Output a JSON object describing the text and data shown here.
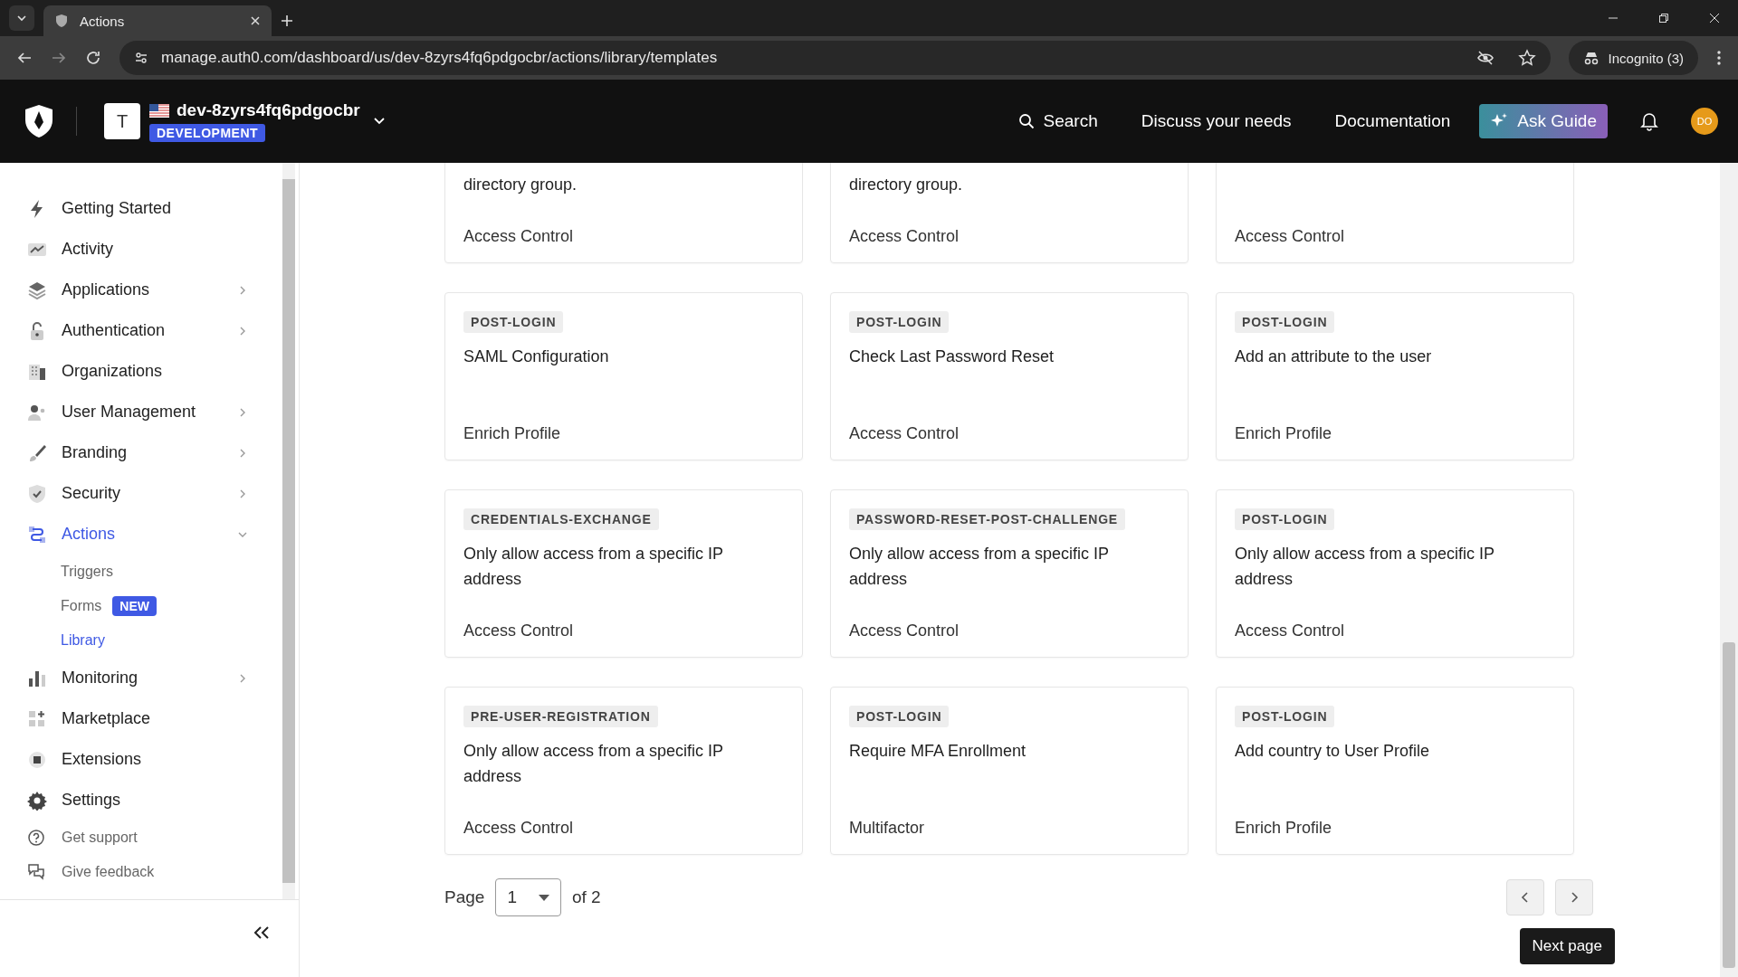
{
  "browser": {
    "tab_title": "Actions",
    "url": "manage.auth0.com/dashboard/us/dev-8zyrs4fq6pdgocbr/actions/library/templates",
    "profile": "Incognito (3)"
  },
  "header": {
    "tenant_initial": "T",
    "tenant_name": "dev-8zyrs4fq6pdgocbr",
    "environment": "DEVELOPMENT",
    "links": [
      "Search",
      "Discuss your needs",
      "Documentation"
    ],
    "ask_button": "Ask Guide",
    "avatar": "DO"
  },
  "sidebar": {
    "items": [
      {
        "label": "Getting Started",
        "selected": false
      },
      {
        "label": "Activity",
        "selected": false
      },
      {
        "label": "Applications",
        "expanded": false,
        "selected": false
      },
      {
        "label": "Authentication",
        "expanded": false,
        "selected": false
      },
      {
        "label": "Organizations",
        "selected": false
      },
      {
        "label": "User Management",
        "expanded": false,
        "selected": false
      },
      {
        "label": "Branding",
        "expanded": false,
        "selected": false
      },
      {
        "label": "Security",
        "expanded": false,
        "selected": false
      },
      {
        "label": "Actions",
        "expanded": true,
        "selected": true,
        "children": [
          {
            "label": "Triggers",
            "selected": false
          },
          {
            "label": "Forms",
            "badge": "NEW",
            "selected": false
          },
          {
            "label": "Library",
            "selected": true
          }
        ]
      },
      {
        "label": "Monitoring",
        "expanded": false,
        "selected": false
      },
      {
        "label": "Marketplace",
        "selected": false
      },
      {
        "label": "Extensions",
        "selected": false
      },
      {
        "label": "Settings",
        "selected": false
      }
    ],
    "footer_links": [
      "Get support",
      "Give feedback"
    ]
  },
  "templates": [
    {
      "title": "directory group.",
      "category": "Access Control"
    },
    {
      "title": "directory group.",
      "category": "Access Control"
    },
    {
      "category": "Access Control"
    },
    {
      "tag": "POST-LOGIN",
      "title": "SAML Configuration",
      "category": "Enrich Profile"
    },
    {
      "tag": "POST-LOGIN",
      "title": "Check Last Password Reset",
      "category": "Access Control"
    },
    {
      "tag": "POST-LOGIN",
      "title": "Add an attribute to the user",
      "category": "Enrich Profile"
    },
    {
      "tag": "CREDENTIALS-EXCHANGE",
      "title": "Only allow access from a specific IP address",
      "category": "Access Control"
    },
    {
      "tag": "PASSWORD-RESET-POST-CHALLENGE",
      "title": "Only allow access from a specific IP address",
      "category": "Access Control"
    },
    {
      "tag": "POST-LOGIN",
      "title": "Only allow access from a specific IP address",
      "category": "Access Control"
    },
    {
      "tag": "PRE-USER-REGISTRATION",
      "title": "Only allow access from a specific IP address",
      "category": "Access Control"
    },
    {
      "tag": "POST-LOGIN",
      "title": "Require MFA Enrollment",
      "category": "Multifactor"
    },
    {
      "tag": "POST-LOGIN",
      "title": "Add country to User Profile",
      "category": "Enrich Profile"
    }
  ],
  "pagination": {
    "label": "Page",
    "page": "1",
    "of": "of 2",
    "tooltip": "Next page"
  }
}
